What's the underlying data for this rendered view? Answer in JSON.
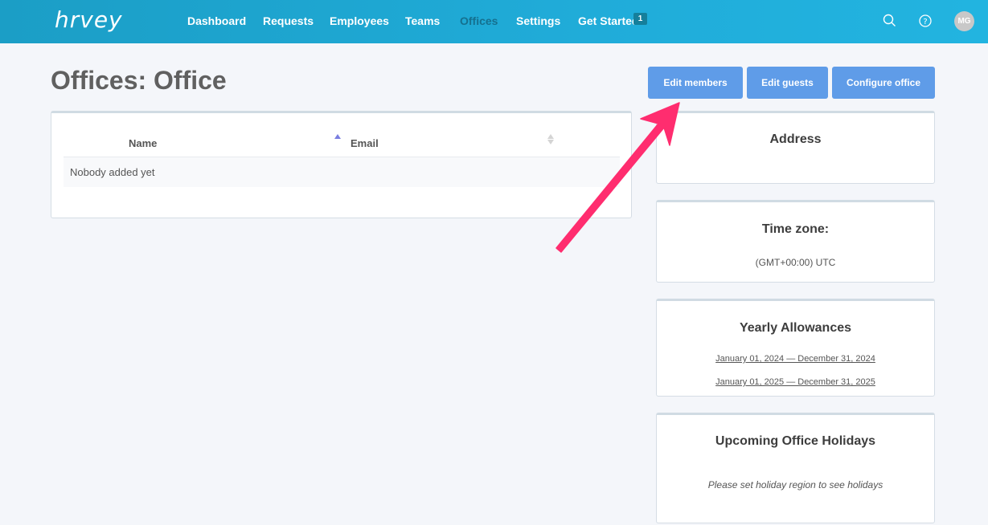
{
  "app": {
    "logo": "hrvey"
  },
  "nav": {
    "items": [
      {
        "label": "Dashboard"
      },
      {
        "label": "Requests"
      },
      {
        "label": "Employees"
      },
      {
        "label": "Teams"
      },
      {
        "label": "Offices",
        "active": true
      },
      {
        "label": "Settings"
      },
      {
        "label": "Get Started"
      }
    ],
    "get_started_badge": "1",
    "avatar_initials": "MG",
    "icons": [
      "search-icon",
      "help-icon"
    ]
  },
  "page": {
    "title": "Offices: Office"
  },
  "actions": {
    "edit_members": "Edit members",
    "edit_guests": "Edit guests",
    "configure_office": "Configure office"
  },
  "members_table": {
    "columns": [
      "Name",
      "Email"
    ],
    "sort": {
      "column": "Name",
      "direction": "asc"
    },
    "empty_message": "Nobody added yet"
  },
  "address_card": {
    "title": "Address"
  },
  "timezone_card": {
    "title": "Time zone:",
    "value": "(GMT+00:00) UTC"
  },
  "allowances_card": {
    "title": "Yearly Allowances",
    "periods": [
      "January 01, 2024 — December 31, 2024",
      "January 01, 2025 — December 31, 2025"
    ]
  },
  "holidays_card": {
    "title": "Upcoming Office Holidays",
    "message": "Please set holiday region to see holidays"
  },
  "colors": {
    "nav_bg": "#1b9ec6",
    "nav_active": "#15708f",
    "button": "#5f9ce8",
    "annotation_arrow": "#ff2d6f",
    "sort_active": "#7a7ee0",
    "page_bg": "#f4f6fa"
  }
}
